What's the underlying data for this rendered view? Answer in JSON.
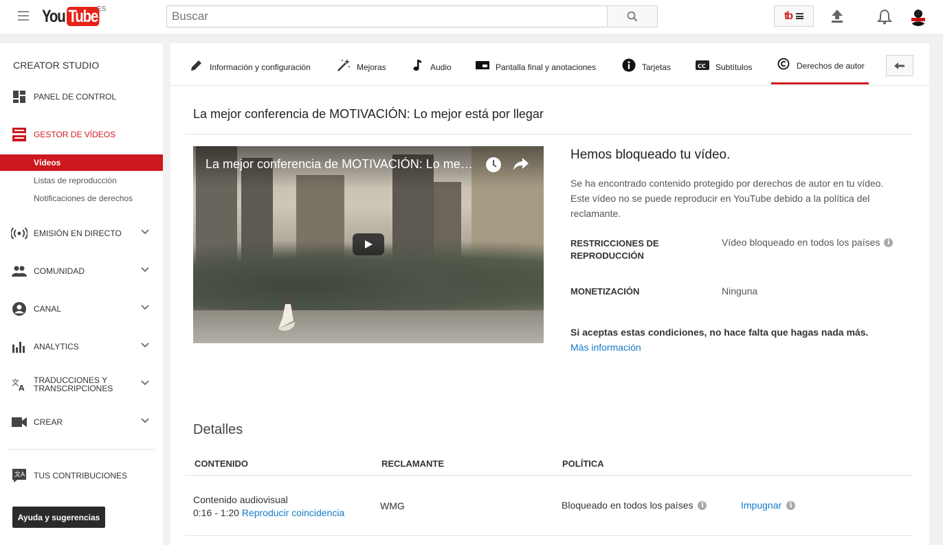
{
  "header": {
    "logo_you": "You",
    "logo_tube": "Tube",
    "country_code": "ES",
    "search_placeholder": "Buscar"
  },
  "sidebar": {
    "title": "CREATOR STUDIO",
    "items": [
      {
        "label": "PANEL DE CONTROL",
        "icon": "dashboard-icon"
      },
      {
        "label": "GESTOR DE VÍDEOS",
        "icon": "video-manager-icon",
        "active": true
      },
      {
        "label": "EMISIÓN EN DIRECTO",
        "icon": "live-icon"
      },
      {
        "label": "COMUNIDAD",
        "icon": "community-icon"
      },
      {
        "label": "CANAL",
        "icon": "channel-icon"
      },
      {
        "label": "ANALYTICS",
        "icon": "analytics-icon"
      },
      {
        "label": "TRADUCCIONES Y TRANSCRIPCIONES",
        "icon": "translate-icon"
      },
      {
        "label": "CREAR",
        "icon": "camera-icon"
      }
    ],
    "subitems": [
      "Vídeos",
      "Listas de reproducción",
      "Notificaciones de derechos"
    ],
    "contributions": "TUS CONTRIBUCIONES",
    "help_button": "Ayuda y sugerencias"
  },
  "tabs": [
    {
      "label": "Información y configuración",
      "icon": "pencil-icon"
    },
    {
      "label": "Mejoras",
      "icon": "magic-wand-icon"
    },
    {
      "label": "Audio",
      "icon": "music-note-icon"
    },
    {
      "label": "Pantalla final y anotaciones",
      "icon": "end-screen-icon"
    },
    {
      "label": "Tarjetas",
      "icon": "info-icon"
    },
    {
      "label": "Subtítulos",
      "icon": "cc-icon"
    },
    {
      "label": "Derechos de autor",
      "icon": "copyright-icon",
      "active": true
    }
  ],
  "video": {
    "title": "La mejor conferencia de MOTIVACIÓN: Lo mejor está por llegar",
    "player_title": "La mejor conferencia de MOTIVACIÓN: Lo mejor está por llegar"
  },
  "block": {
    "heading": "Hemos bloqueado tu vídeo.",
    "description": "Se ha encontrado contenido protegido por derechos de autor en tu vídeo. Este vídeo no se puede reproducir en YouTube debido a la política del reclamante.",
    "restrictions_label": "RESTRICCIONES DE REPRODUCCIÓN",
    "restrictions_value": "Vídeo bloqueado en todos los países",
    "monetization_label": "MONETIZACIÓN",
    "monetization_value": "Ninguna",
    "accept_text": "Si aceptas estas condiciones, no hace falta que hagas nada más.",
    "more_info": "Más información"
  },
  "details": {
    "heading": "Detalles",
    "columns": [
      "CONTENIDO",
      "RECLAMANTE",
      "POLÍTICA"
    ],
    "rows": [
      {
        "content": "Contenido audiovisual",
        "time": "0:16 - 1:20",
        "play_match": "Reproducir coincidencia",
        "claimant": "WMG",
        "policy": "Bloqueado en todos los países",
        "action": "Impugnar"
      }
    ]
  },
  "colors": {
    "accent": "#cc181e",
    "link": "#167ac6"
  }
}
